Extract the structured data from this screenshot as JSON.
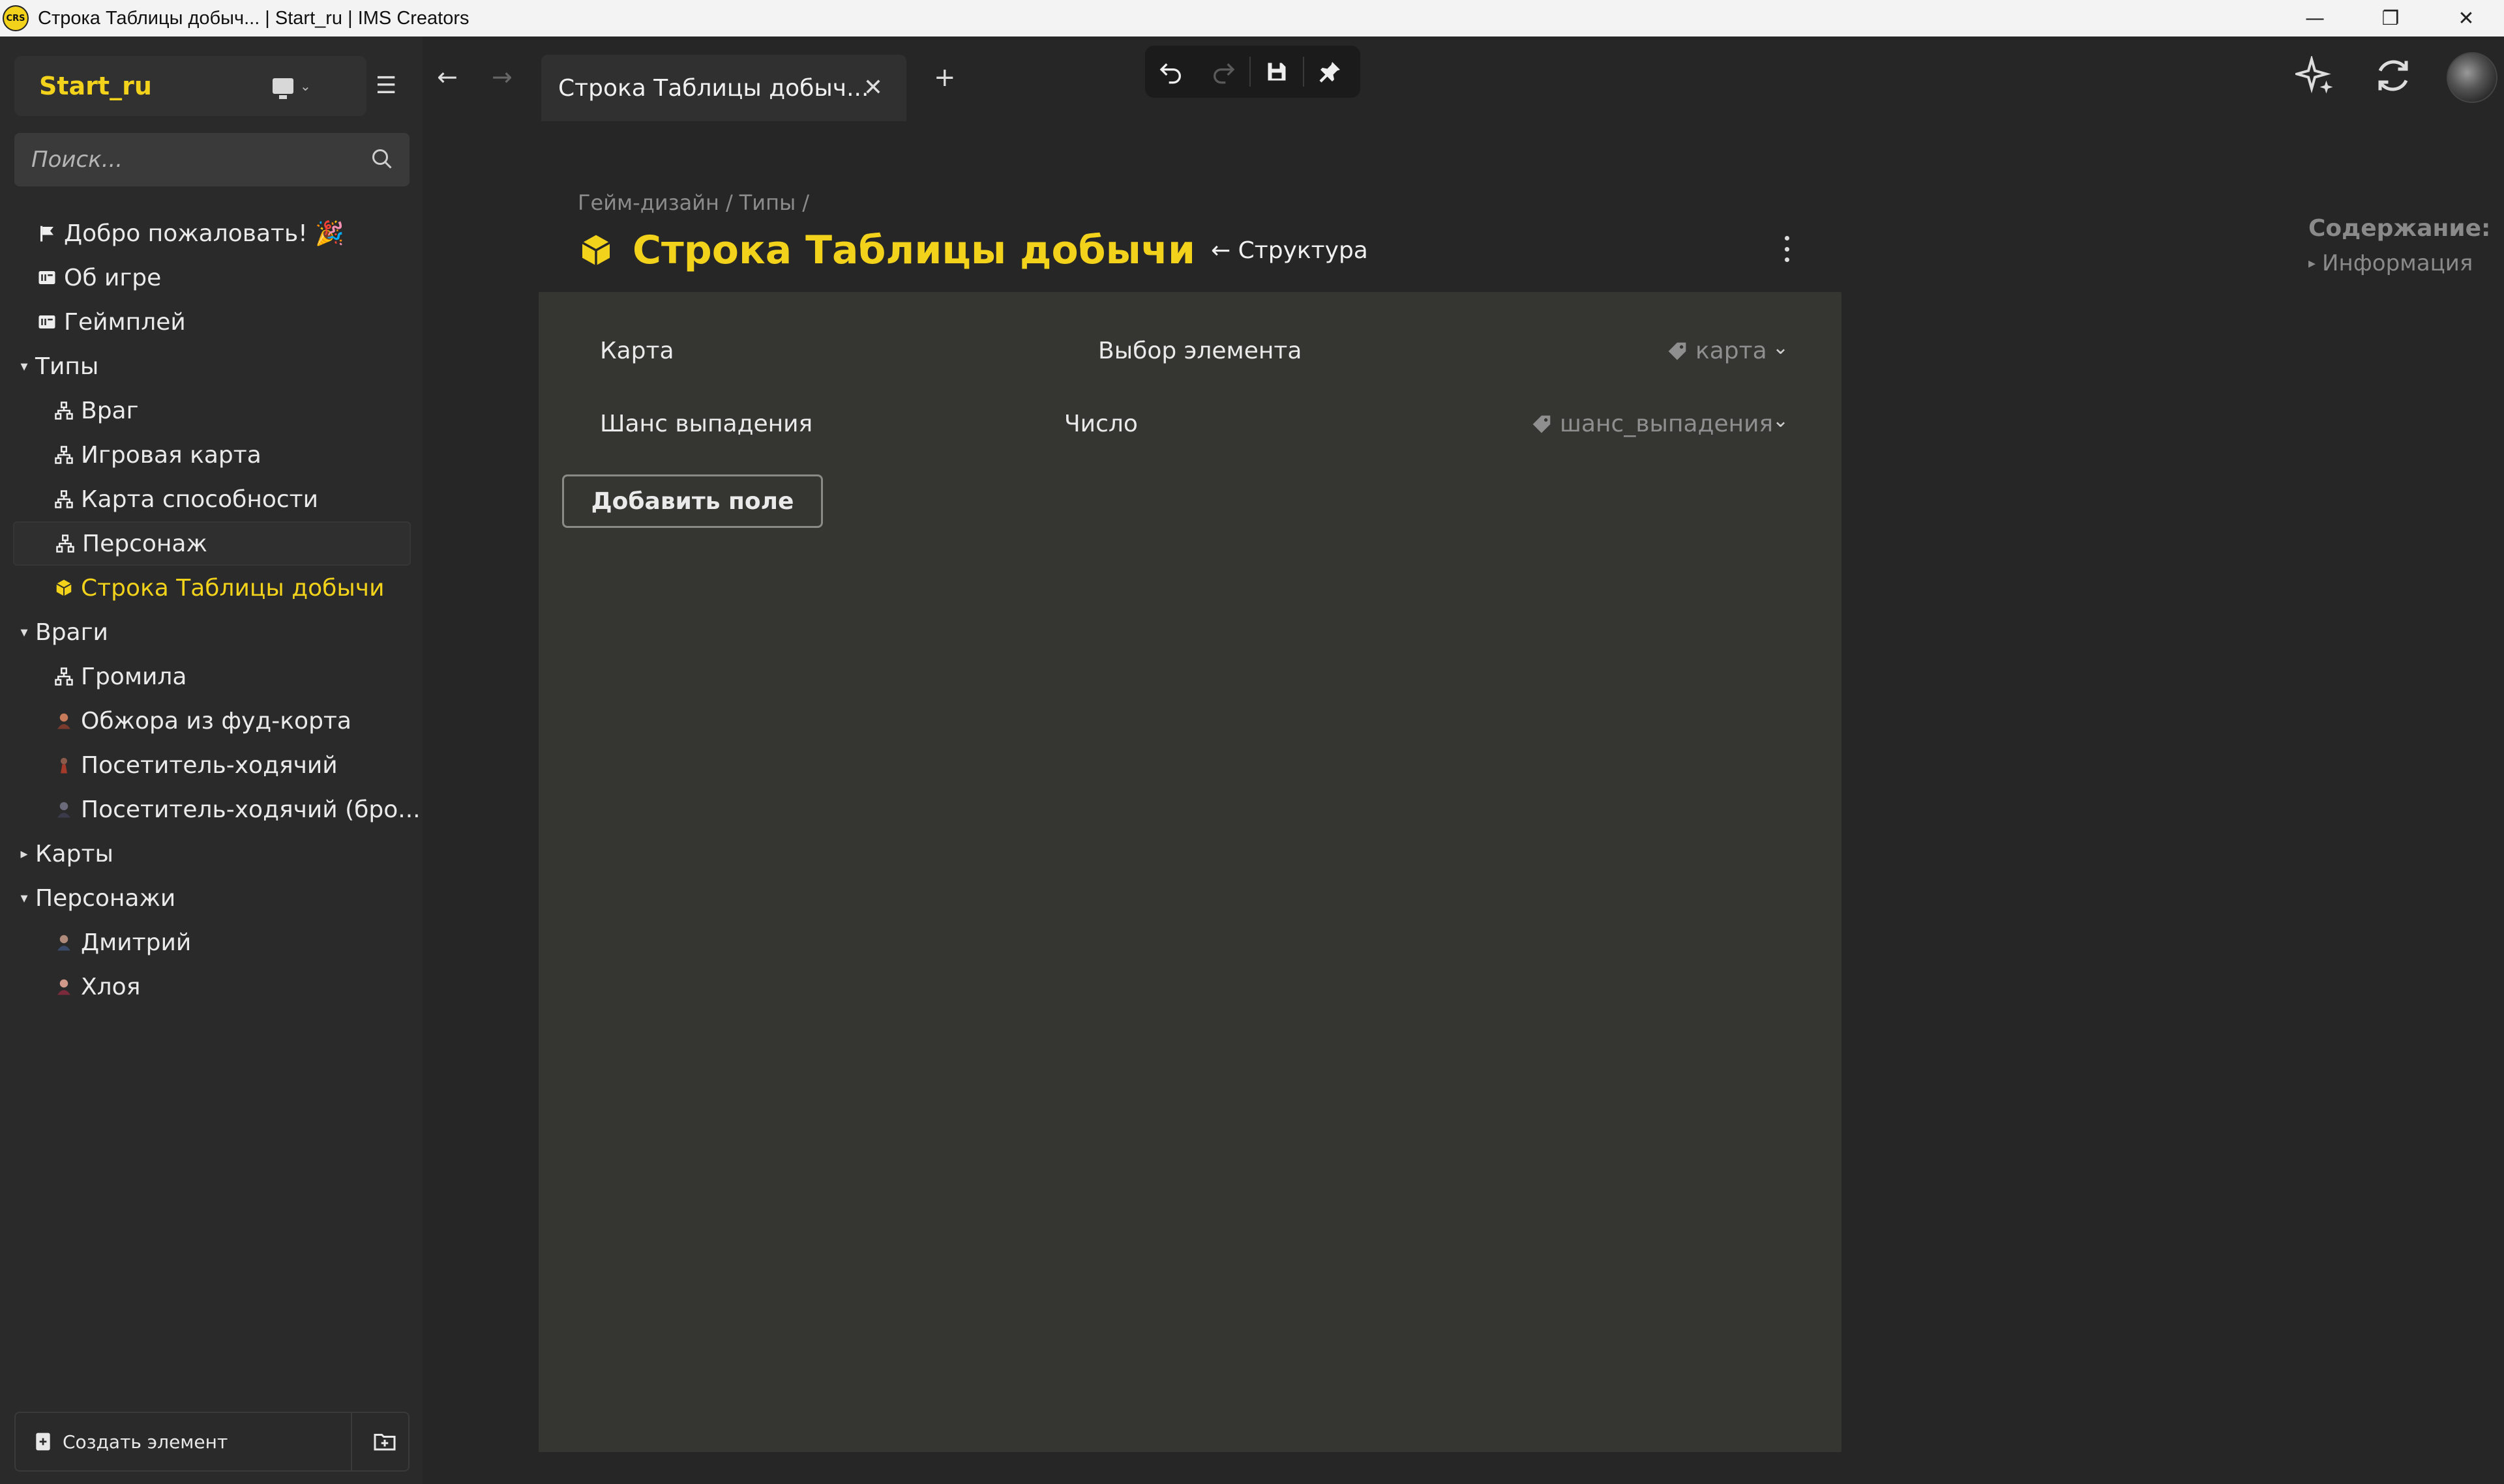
{
  "window": {
    "logo_text": "CRS",
    "title": "Строка Таблицы добыч... | Start_ru | IMS Creators",
    "minimize": "—",
    "maximize": "❐",
    "close": "✕"
  },
  "sidebar": {
    "project_name": "Start_ru",
    "search_placeholder": "Поиск...",
    "tree": [
      {
        "label": "Добро пожаловать! 🎉",
        "icon": "flag-icon",
        "level": 0
      },
      {
        "label": "Об игре",
        "icon": "document-icon",
        "level": 0
      },
      {
        "label": "Геймплей",
        "icon": "document-icon",
        "level": 0
      },
      {
        "label": "Типы",
        "icon": "caret-down-icon",
        "level": 0
      },
      {
        "label": "Враг",
        "icon": "hierarchy-icon",
        "level": 1
      },
      {
        "label": "Игровая карта",
        "icon": "hierarchy-icon",
        "level": 1
      },
      {
        "label": "Карта способности",
        "icon": "hierarchy-icon",
        "level": 1
      },
      {
        "label": "Персонаж",
        "icon": "hierarchy-icon",
        "level": 1
      },
      {
        "label": "Строка Таблицы добычи",
        "icon": "cube-icon",
        "level": 1
      },
      {
        "label": "Враги",
        "icon": "caret-down-icon",
        "level": 0
      },
      {
        "label": "Громила",
        "icon": "hierarchy-icon",
        "level": 1
      },
      {
        "label": "Обжора из фуд-корта",
        "icon": "character-avatar-icon",
        "level": 1
      },
      {
        "label": "Посетитель-ходячий",
        "icon": "character-avatar-icon",
        "level": 1
      },
      {
        "label": "Посетитель-ходячий (бро...",
        "icon": "character-avatar-icon",
        "level": 1
      },
      {
        "label": "Карты",
        "icon": "caret-right-icon",
        "level": 0
      },
      {
        "label": "Персонажи",
        "icon": "caret-down-icon",
        "level": 0
      },
      {
        "label": "Дмитрий",
        "icon": "character-avatar-icon",
        "level": 1
      },
      {
        "label": "Хлоя",
        "icon": "character-avatar-icon",
        "level": 1
      }
    ],
    "create_label": "Создать элемент"
  },
  "tabs": [
    {
      "label": "Строка Таблицы добыч..."
    }
  ],
  "breadcrumb": [
    "Гейм-дизайн",
    "Типы"
  ],
  "page": {
    "title": "Строка Таблицы добычи",
    "structure_link": "← Структура"
  },
  "fields": [
    {
      "name": "Карта",
      "type": "Выбор элемента",
      "key": "карта"
    },
    {
      "name": "Шанс выпадения",
      "type": "Число",
      "key": "шанс_выпадения"
    }
  ],
  "add_field_label": "Добавить поле",
  "toc": {
    "title": "Содержание:",
    "items": [
      "Информация"
    ]
  },
  "colors": {
    "accent": "#f2d21b",
    "background": "#262626",
    "sidebar": "#2a2a2a",
    "panel": "#353532"
  }
}
